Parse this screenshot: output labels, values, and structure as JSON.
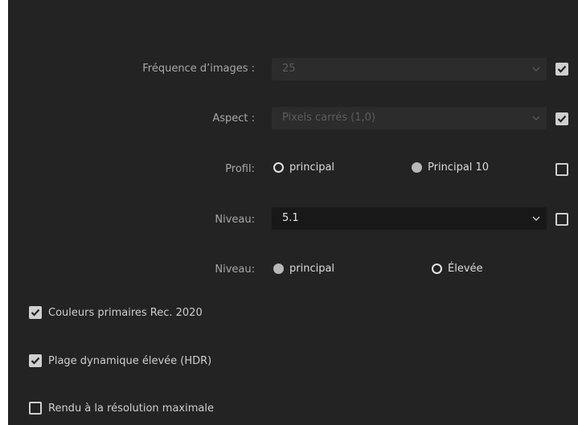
{
  "frame_rate": {
    "label": "Fréquence d’images :",
    "value": "25",
    "checked": true
  },
  "aspect": {
    "label": "Aspect :",
    "value": "Pixels carrés (1,0)",
    "checked": true
  },
  "profile": {
    "label": "Profil:",
    "options": [
      "principal",
      "Principal 10"
    ],
    "selected": "Principal 10",
    "checked": false
  },
  "level": {
    "label": "Niveau:",
    "value": "5.1",
    "checked": false
  },
  "tier": {
    "label": "Niveau:",
    "options": [
      "principal",
      "Élevée"
    ],
    "selected": "principal"
  },
  "options": [
    {
      "label": "Couleurs primaires Rec. 2020",
      "checked": true
    },
    {
      "label": "Plage dynamique élevée (HDR)",
      "checked": true
    },
    {
      "label": "Rendu à la résolution maximale",
      "checked": false
    }
  ],
  "colors": {
    "background": "#232323",
    "dropdown_disabled": "#2c2c2c",
    "dropdown_enabled": "#181818",
    "checkbox": "#cfcfcf"
  }
}
